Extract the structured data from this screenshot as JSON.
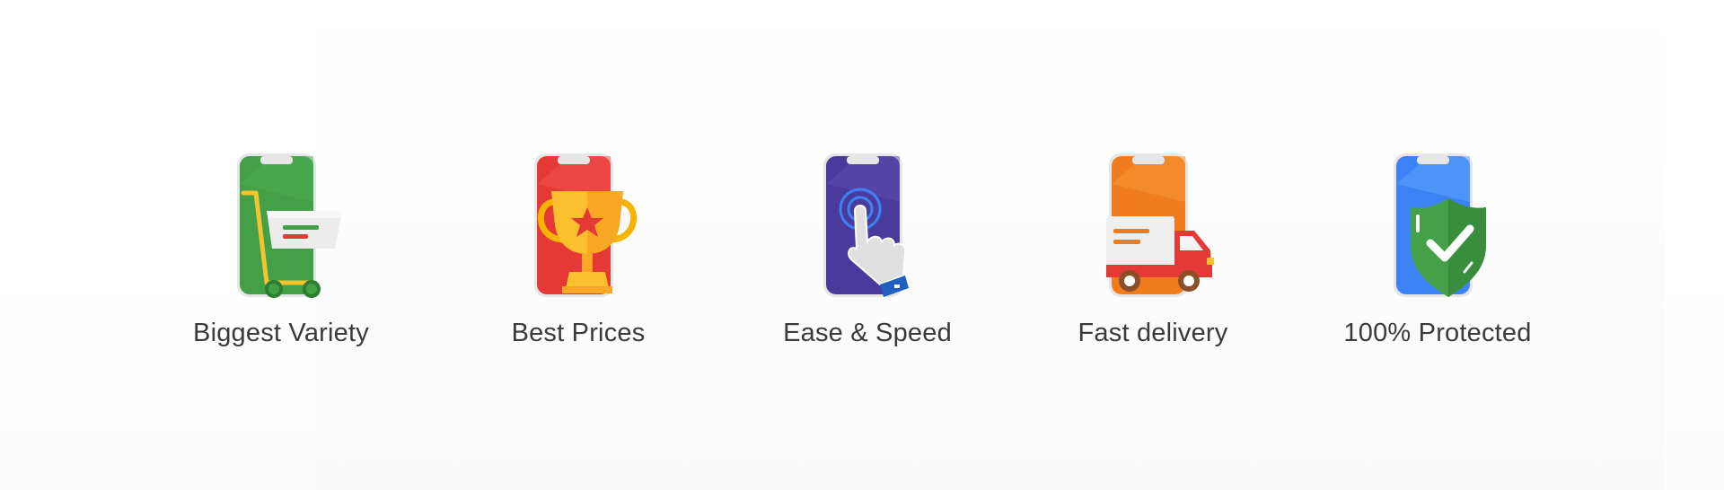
{
  "features": [
    {
      "label": "Biggest Variety",
      "icon": "shopping-cart-phone-icon",
      "color": "#3d9b3d"
    },
    {
      "label": "Best Prices",
      "icon": "trophy-phone-icon",
      "color": "#e53935"
    },
    {
      "label": "Ease & Speed",
      "icon": "tap-hand-phone-icon",
      "color": "#4a3a9c"
    },
    {
      "label": "Fast delivery",
      "icon": "delivery-truck-phone-icon",
      "color": "#f07c1e"
    },
    {
      "label": "100% Protected",
      "icon": "shield-check-phone-icon",
      "color": "#3b82f6"
    }
  ]
}
